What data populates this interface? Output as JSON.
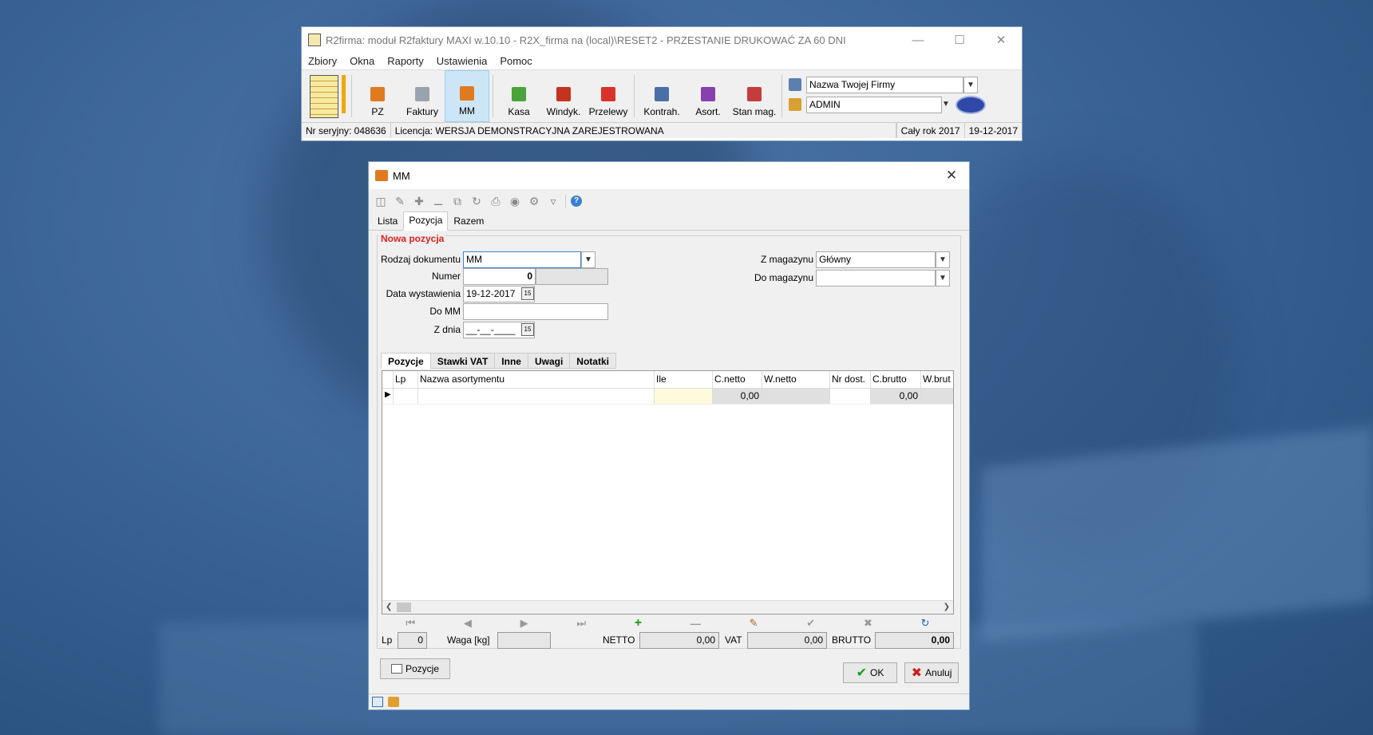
{
  "main": {
    "title": "R2firma: moduł R2faktury MAXI w.10.10 - R2X_firma na (local)\\RESET2 - PRZESTANIE DRUKOWAĆ ZA 60 DNI",
    "menu": [
      "Zbiory",
      "Okna",
      "Raporty",
      "Ustawienia",
      "Pomoc"
    ],
    "toolbar": [
      {
        "label": "PZ",
        "color": "#e07a20"
      },
      {
        "label": "Faktury",
        "color": "#9aa3ad"
      },
      {
        "label": "MM",
        "color": "#e07a20"
      },
      {
        "label": "Kasa",
        "color": "#4aa33a"
      },
      {
        "label": "Windyk.",
        "color": "#c4331e"
      },
      {
        "label": "Przelewy",
        "color": "#d8322a"
      },
      {
        "label": "Kontrah.",
        "color": "#4a6fa8"
      },
      {
        "label": "Asort.",
        "color": "#8a3fb0"
      },
      {
        "label": "Stan mag.",
        "color": "#c43c3c"
      }
    ],
    "company": "Nazwa Twojej Firmy",
    "user": "ADMIN",
    "status": {
      "serial": "Nr seryjny: 048636",
      "license": "Licencja: WERSJA DEMONSTRACYJNA ZAREJESTROWANA",
      "period": "Cały rok 2017",
      "date": "19-12-2017"
    }
  },
  "dialog": {
    "title": "MM",
    "tabs": [
      "Lista",
      "Pozycja",
      "Razem"
    ],
    "section": "Nowa pozycja",
    "form": {
      "rodzaj_label": "Rodzaj dokumentu",
      "rodzaj": "MM",
      "numer_label": "Numer",
      "numer": "0",
      "data_label": "Data wystawienia",
      "data": "19-12-2017",
      "domm_label": "Do MM",
      "domm": "",
      "zdnia_label": "Z dnia",
      "zdnia": "__-__-____",
      "zmag_label": "Z magazynu",
      "zmag": "Główny",
      "domag_label": "Do magazynu",
      "domag": ""
    },
    "subtabs": [
      "Pozycje",
      "Stawki VAT",
      "Inne",
      "Uwagi",
      "Notatki"
    ],
    "columns": [
      "Lp",
      "Nazwa asortymentu",
      "Ile",
      "C.netto",
      "W.netto",
      "Nr dost.",
      "C.brutto",
      "W.brut"
    ],
    "row": {
      "cnetto": "0,00",
      "cbrutto": "0,00"
    },
    "totals": {
      "lp_label": "Lp",
      "lp": "0",
      "waga_label": "Waga [kg]",
      "waga": "",
      "netto_label": "NETTO",
      "netto": "0,00",
      "vat_label": "VAT",
      "vat": "0,00",
      "brutto_label": "BRUTTO",
      "brutto": "0,00"
    },
    "buttons": {
      "pozycje": "Pozycje",
      "ok": "OK",
      "anuluj": "Anuluj"
    }
  }
}
